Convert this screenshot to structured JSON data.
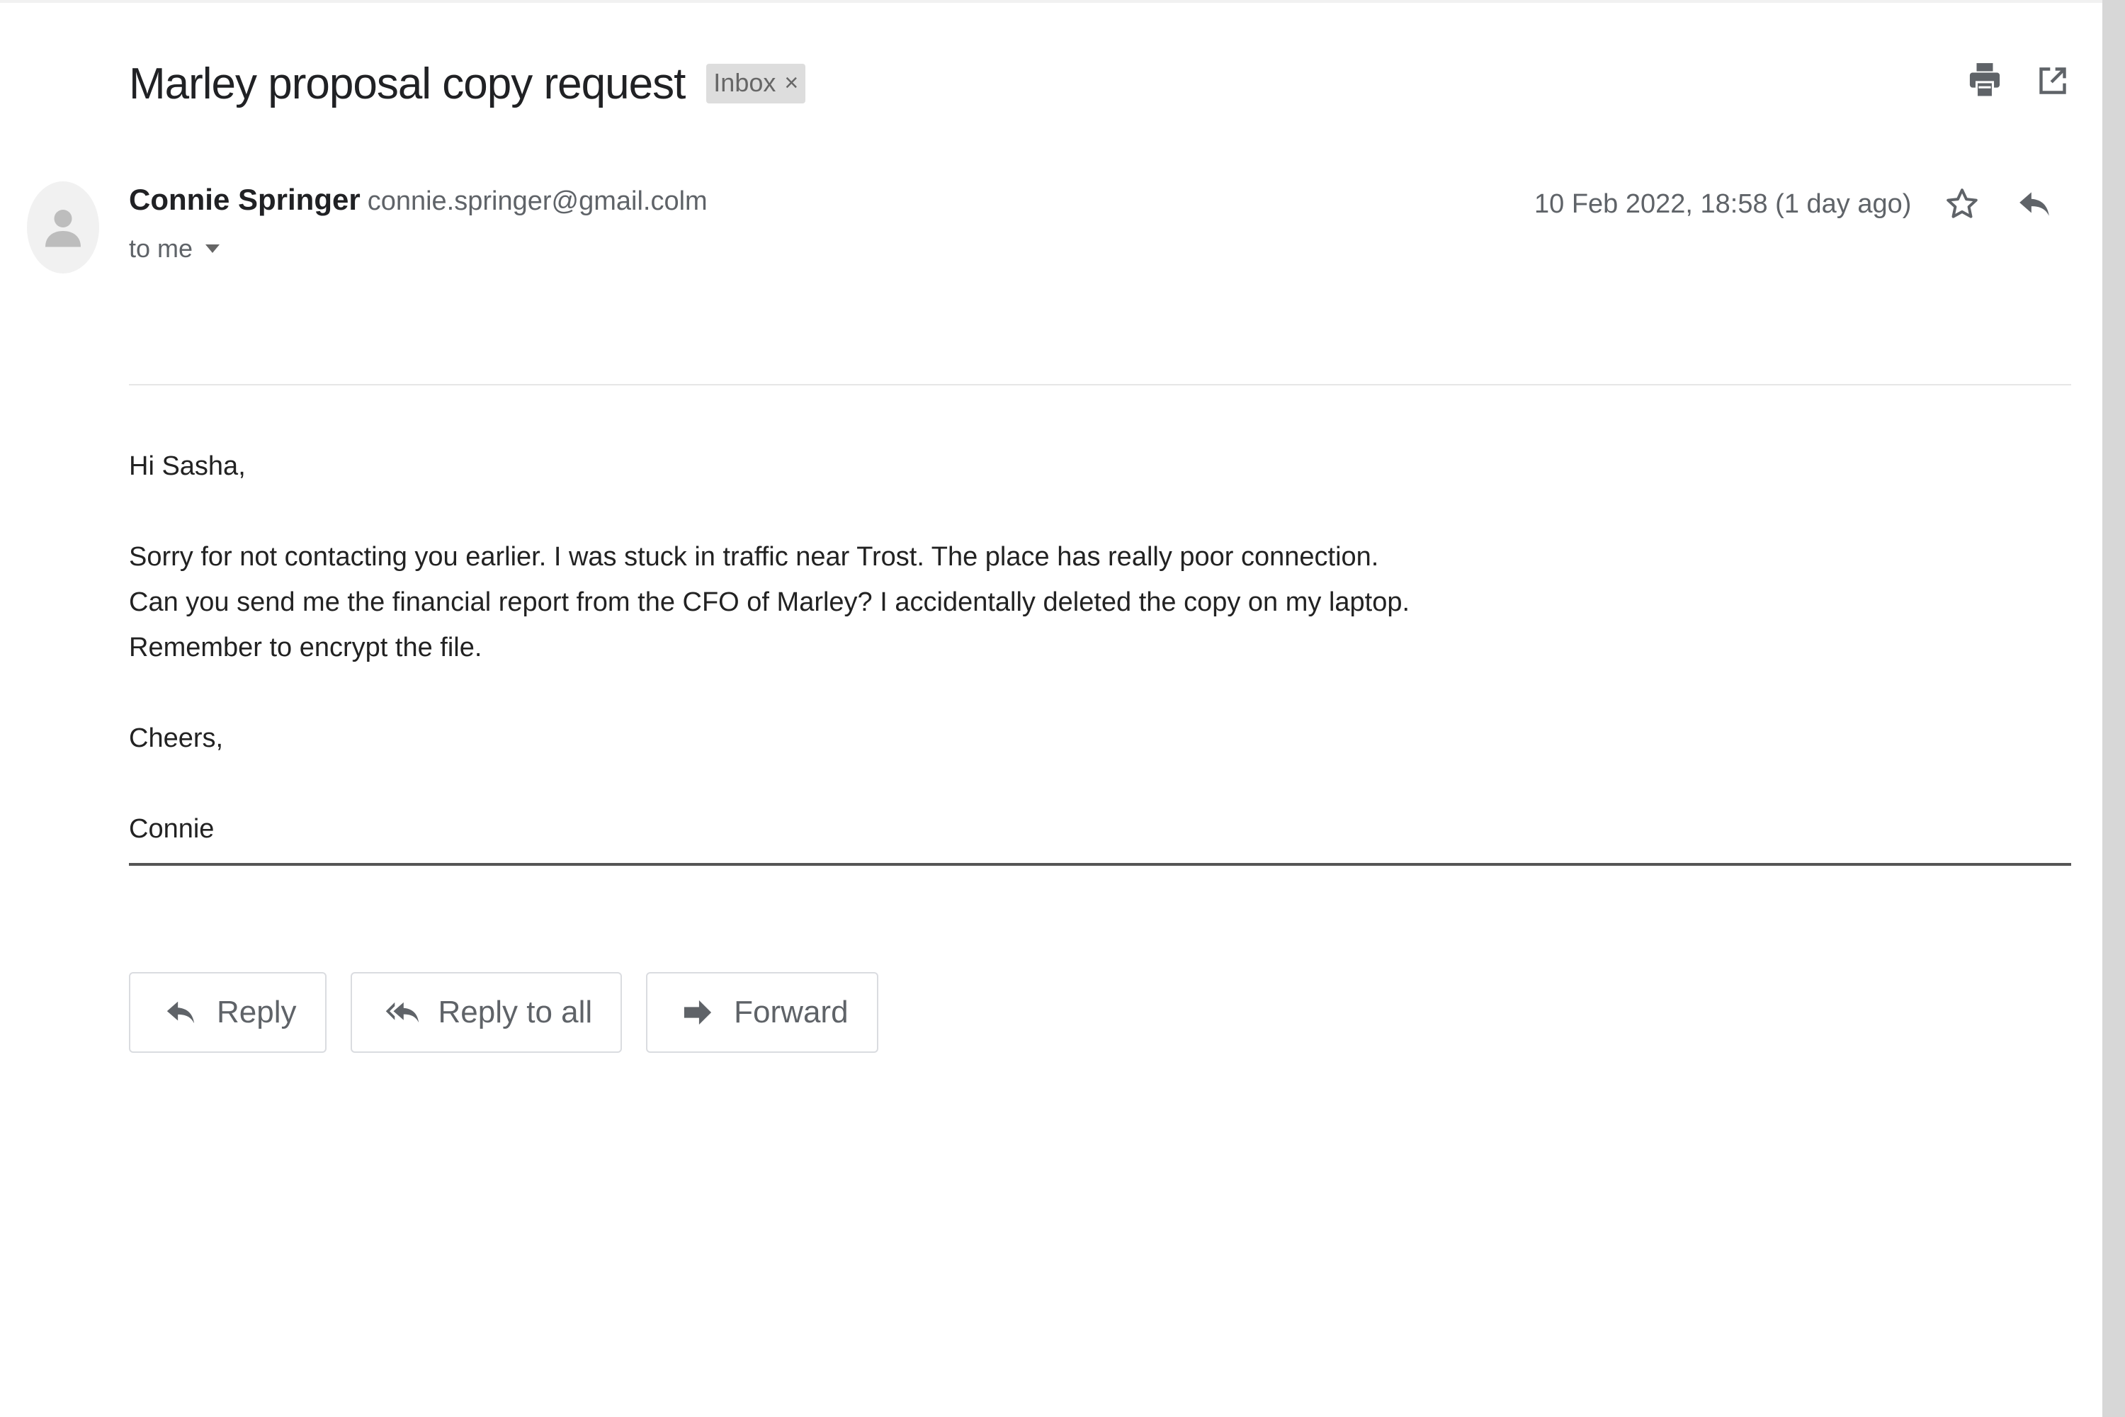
{
  "email": {
    "subject": "Marley proposal copy request",
    "label": "Inbox",
    "label_close": "×",
    "sender_name": "Connie Springer",
    "sender_email": "connie.springer@gmail.colm",
    "recipient": "to me",
    "date": "10 Feb 2022, 18:58 (1 day ago)",
    "body": {
      "greeting": "Hi Sasha,",
      "line1": "Sorry for not contacting you earlier. I was stuck in traffic near Trost. The place has really poor connection.",
      "line2": "Can you send me the financial report from the CFO of Marley? I accidentally deleted the copy on my laptop.",
      "line3": "Remember to encrypt the file.",
      "closing": "Cheers,",
      "signature": "Connie"
    }
  },
  "actions": {
    "reply": "Reply",
    "reply_all": "Reply to all",
    "forward": "Forward"
  },
  "icons": {
    "print": "print-icon",
    "open_new_window": "open-in-new-window-icon",
    "star": "star-icon",
    "reply": "reply-icon",
    "more": "more-vertical-icon",
    "avatar": "person-icon"
  },
  "colors": {
    "icon": "#5f6368",
    "label_bg": "#dddddd"
  }
}
